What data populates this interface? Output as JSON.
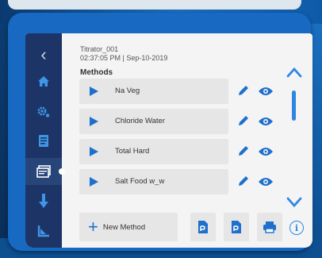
{
  "header": {
    "device_name": "Titrator_001",
    "timestamp": "02:37:05 PM | Sep-10-2019"
  },
  "sidebar": {
    "items": [
      {
        "icon": "back-chevron-icon",
        "glyph": "‹"
      },
      {
        "icon": "home-icon"
      },
      {
        "icon": "settings-icon"
      },
      {
        "icon": "document-icon"
      },
      {
        "icon": "methods-icon",
        "active": true
      },
      {
        "icon": "probe-icon"
      },
      {
        "icon": "chart-icon"
      }
    ]
  },
  "methods": {
    "title": "Methods",
    "items": [
      {
        "label": "Na Veg"
      },
      {
        "label": "Chloride Water"
      },
      {
        "label": "Total Hard"
      },
      {
        "label": "Salt Food w_w"
      }
    ]
  },
  "footer": {
    "new_method_label": "New Method",
    "plus_glyph": "+",
    "info_glyph": "i"
  },
  "colors": {
    "accent": "#1f6fcc",
    "sidebar_bg": "#1d3566",
    "device_frame": "#1769c2"
  }
}
